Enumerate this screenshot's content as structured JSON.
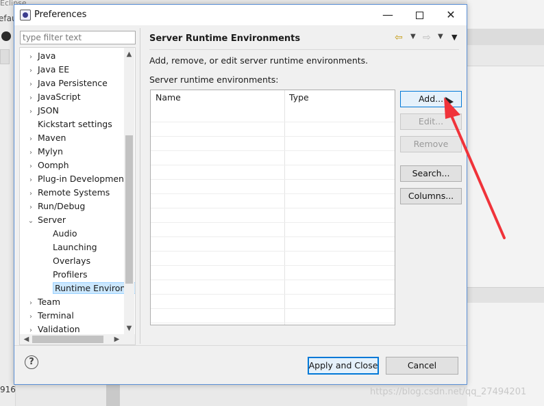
{
  "background": {
    "eclipse_title": "Eclipse",
    "side_text": "efau",
    "bottom_number": "916",
    "watermark": "https://blog.csdn.net/qq_27494201"
  },
  "dialog": {
    "title": "Preferences",
    "filter_placeholder": "type filter text",
    "tree": [
      {
        "label": "Java",
        "expander": "›",
        "indent": 0
      },
      {
        "label": "Java EE",
        "expander": "›",
        "indent": 0
      },
      {
        "label": "Java Persistence",
        "expander": "›",
        "indent": 0
      },
      {
        "label": "JavaScript",
        "expander": "›",
        "indent": 0
      },
      {
        "label": "JSON",
        "expander": "›",
        "indent": 0
      },
      {
        "label": "Kickstart settings",
        "expander": "",
        "indent": 0
      },
      {
        "label": "Maven",
        "expander": "›",
        "indent": 0
      },
      {
        "label": "Mylyn",
        "expander": "›",
        "indent": 0
      },
      {
        "label": "Oomph",
        "expander": "›",
        "indent": 0
      },
      {
        "label": "Plug-in Development",
        "expander": "›",
        "indent": 0
      },
      {
        "label": "Remote Systems",
        "expander": "›",
        "indent": 0
      },
      {
        "label": "Run/Debug",
        "expander": "›",
        "indent": 0
      },
      {
        "label": "Server",
        "expander": "⌄",
        "indent": 0
      },
      {
        "label": "Audio",
        "expander": "",
        "indent": 1
      },
      {
        "label": "Launching",
        "expander": "",
        "indent": 1
      },
      {
        "label": "Overlays",
        "expander": "",
        "indent": 1
      },
      {
        "label": "Profilers",
        "expander": "",
        "indent": 1
      },
      {
        "label": "Runtime Environm",
        "expander": "",
        "indent": 1,
        "selected": true
      },
      {
        "label": "Team",
        "expander": "›",
        "indent": 0
      },
      {
        "label": "Terminal",
        "expander": "›",
        "indent": 0
      },
      {
        "label": "Validation",
        "expander": "›",
        "indent": 0
      }
    ],
    "page": {
      "title": "Server Runtime Environments",
      "description": "Add, remove, or edit server runtime environments.",
      "list_label": "Server runtime environments:",
      "columns": [
        "Name",
        "Type"
      ],
      "buttons": {
        "add": "Add...",
        "edit": "Edit...",
        "remove": "Remove",
        "search": "Search...",
        "columns": "Columns..."
      }
    },
    "footer": {
      "apply_close": "Apply and Close",
      "cancel": "Cancel",
      "help": "?"
    }
  },
  "colors": {
    "annotation_arrow": "#f0333a",
    "selection": "#cce8ff",
    "focus_border": "#0078d7"
  }
}
